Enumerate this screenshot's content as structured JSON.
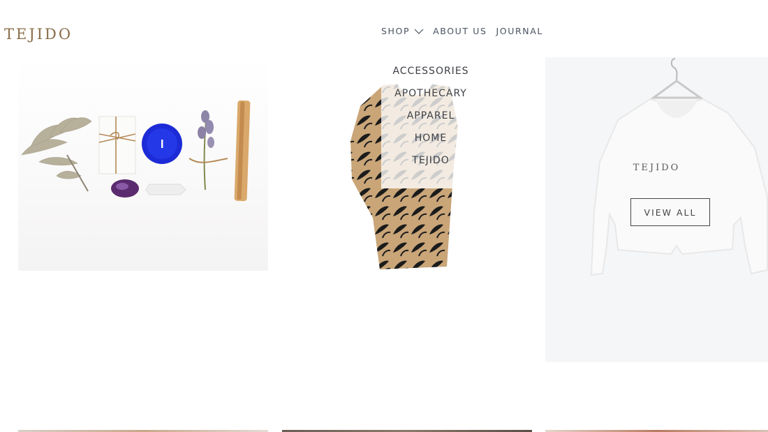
{
  "header": {
    "logo": "TEJIDO",
    "nav": [
      {
        "label": "SHOP",
        "icon": "chevron-down-icon"
      },
      {
        "label": "ABOUT US"
      },
      {
        "label": "JOURNAL"
      }
    ]
  },
  "shop_dropdown": {
    "items": [
      "ACCESSORIES",
      "APOTHECARY",
      "APPAREL",
      "HOME",
      "TEJIDO"
    ]
  },
  "featured_tile": {
    "brand": "TEJIDO",
    "button_label": "VIEW ALL"
  },
  "colors": {
    "logo": "#8a6d4a",
    "nav_text": "#4a5260",
    "tile_bg": "#f5f6f8",
    "candle_blue": "#1c2bd6",
    "amethyst": "#5a2b6e"
  }
}
